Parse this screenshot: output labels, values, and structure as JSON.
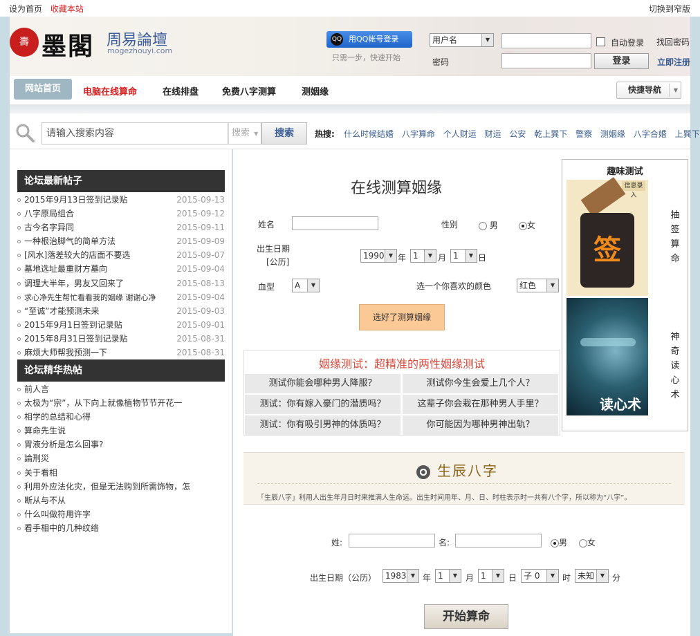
{
  "topbar": {
    "set_home": "设为首页",
    "favorite": "收藏本站",
    "switch": "切换到窄版"
  },
  "logo": {
    "seal": "壽",
    "main": "墨閣",
    "cn": "周易論壇",
    "en": "mogezhouyi.com"
  },
  "login": {
    "qq_label": "用QQ帐号登录",
    "qq_tip": "只需一步，快速开始",
    "user_select": "用户名",
    "password_label": "密码",
    "auto_login": "自动登录",
    "find_password": "找回密码",
    "login_button": "登录",
    "register": "立即注册"
  },
  "nav": {
    "items": [
      "网站首页",
      "电脑在线算命",
      "在线排盘",
      "免费八字测算",
      "测姻缘"
    ],
    "quick_nav": "快捷导航"
  },
  "search": {
    "placeholder": "请输入搜索内容",
    "type": "搜索",
    "button": "搜索",
    "hot_label": "热搜:",
    "hot": [
      "什么时候结婚",
      "八字算命",
      "个人财运",
      "财运",
      "公安",
      "乾上巽下",
      "警察",
      "测姻缘",
      "八字合婚",
      "上巽下乾"
    ]
  },
  "latest": {
    "title": "论坛最新帖子",
    "posts": [
      {
        "title": "2015年9月13日签到记录贴",
        "date": "2015-09-13"
      },
      {
        "title": "八字原局组合",
        "date": "2015-09-12"
      },
      {
        "title": "古今名字异同",
        "date": "2015-09-11"
      },
      {
        "title": "一种根治脚气的简单方法",
        "date": "2015-09-09"
      },
      {
        "title": "[风水]落差较大的店面不要选",
        "date": "2015-09-07"
      },
      {
        "title": "墓地选址最重财方墓向",
        "date": "2015-09-04"
      },
      {
        "title": "调理大半年，男友又回来了",
        "date": "2015-08-13"
      },
      {
        "title": "求心净先生帮忙看看我的姻缘 谢谢心净",
        "date": "2015-09-04"
      },
      {
        "title": "“至诚”才能预测未来",
        "date": "2015-09-03"
      },
      {
        "title": "2015年9月1日签到记录贴",
        "date": "2015-09-01"
      },
      {
        "title": "2015年8月31日签到记录贴",
        "date": "2015-08-31"
      },
      {
        "title": "麻烦大师帮我预测一下",
        "date": "2015-08-31"
      }
    ]
  },
  "featured": {
    "title": "论坛精华热帖",
    "posts": [
      "前人言",
      "太极为“宗”，从下向上就像植物节节开花一",
      "相学的总结和心得",
      "算命先生说",
      "胃液分析是怎么回事?",
      "論刑災",
      "关于看相",
      "利用外应法化灾，但是无法购到所需饰物，怎",
      "断从与不从",
      "什么叫做符用许字",
      "看手相中的几种纹络"
    ]
  },
  "marriage": {
    "title": "在线测算姻缘",
    "name_label": "姓名",
    "gender_label": "性别",
    "male": "男",
    "female": "女",
    "birth_label": "出生日期",
    "calendar": "[公历]",
    "year": "1990",
    "year_unit": "年",
    "month": "1",
    "month_unit": "月",
    "day": "1",
    "day_unit": "日",
    "blood_label": "血型",
    "blood": "A",
    "color_label": "选一个你喜欢的颜色",
    "color": "红色",
    "submit": "选好了测算姻缘"
  },
  "love_test": {
    "title": "姻缘测试：超精准的两性姻缘测试",
    "items": [
      "测试你能会哪种男人降服？",
      "测试你今生会爱上几个人？",
      "测试：你有嫁入豪门的潜质吗？",
      "这辈子你会栽在那种男人手里？",
      "测试：你有吸引男神的体质吗？",
      "你可能因为哪种男神出轨？"
    ]
  },
  "fun_test": {
    "title": "趣味测试",
    "item1": {
      "label": "抽签算命",
      "img_text": "签",
      "img_top": "信息录入"
    },
    "item2": {
      "label": "神奇读心术",
      "img_text": "读心术"
    }
  },
  "bazi": {
    "title": "生辰八字",
    "desc": "「生辰八字」利用人出生年月日时来推满人生命运。出生时间用年、月、日、时柱表示时一共有八个字，所以称为“八字”。",
    "surname_label": "姓:",
    "name_label": "名:",
    "male": "男",
    "female": "女",
    "birth_label": "出生日期（公历）",
    "year": "1983",
    "year_unit": "年",
    "month": "1",
    "month_unit": "月",
    "day": "1",
    "day_unit": "日",
    "hour": "子 0",
    "hour_unit": "时",
    "minute": "未知",
    "minute_unit": "分",
    "start": "开始算命"
  },
  "colors": {
    "accent_red": "#d42020",
    "link_blue": "#3a5d92",
    "nav_active": "#9fb7c3",
    "dark_header": "#333333"
  }
}
